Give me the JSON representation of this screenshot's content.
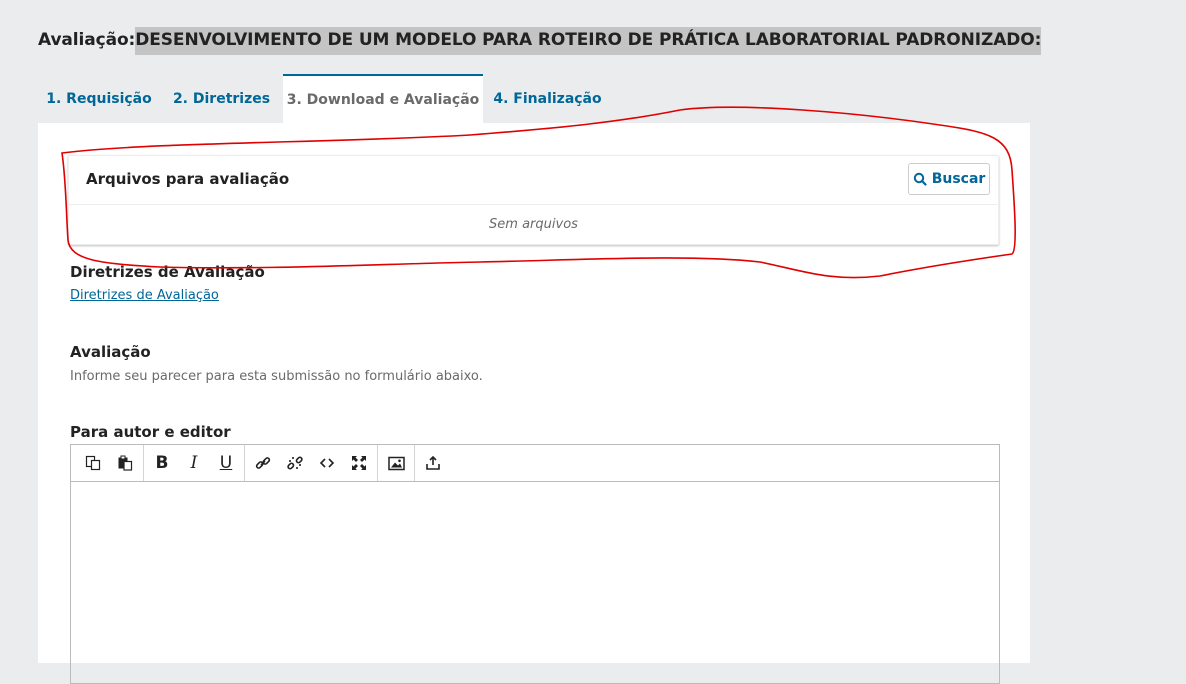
{
  "page": {
    "title_prefix": "Avaliação:",
    "title_highlight": "DESENVOLVIMENTO DE UM MODELO PARA ROTEIRO DE PRÁTICA LABORATORIAL PADRONIZADO:"
  },
  "tabs": [
    {
      "label": "1. Requisição",
      "active": false
    },
    {
      "label": "2. Diretrizes",
      "active": false
    },
    {
      "label": "3. Download e Avaliação",
      "active": true
    },
    {
      "label": "4. Finalização",
      "active": false
    }
  ],
  "files": {
    "title": "Arquivos para avaliação",
    "search_label": "Buscar",
    "empty_text": "Sem arquivos"
  },
  "guidelines": {
    "title": "Diretrizes de Avaliação",
    "link_text": "Diretrizes de Avaliação"
  },
  "evaluation": {
    "title": "Avaliação",
    "description": "Informe seu parecer para esta submissão no formulário abaixo."
  },
  "comments": {
    "title": "Para autor e editor",
    "toolbar": [
      "copy-icon",
      "paste-icon",
      "bold-icon",
      "italic-icon",
      "underline-icon",
      "link-icon",
      "unlink-icon",
      "code-icon",
      "fullscreen-icon",
      "image-icon",
      "upload-icon"
    ],
    "editor_value": ""
  },
  "colors": {
    "accent": "#006798",
    "background": "#eaeced",
    "highlight": "#c4c4c4",
    "annotation": "#e00000"
  }
}
